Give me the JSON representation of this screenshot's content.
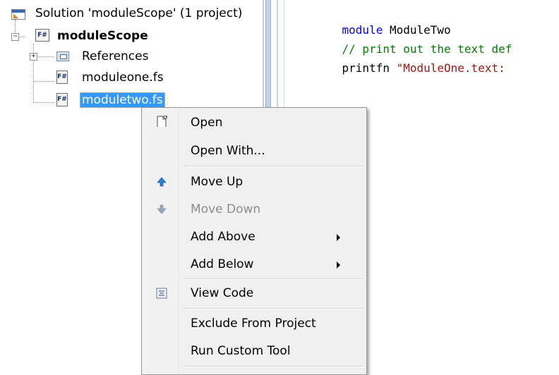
{
  "solution_explorer": {
    "solution_label": "Solution 'moduleScope' (1 project)",
    "project_label": "moduleScope",
    "project_icon_text": "F#",
    "items": [
      {
        "label": "References",
        "icon": "references-icon"
      },
      {
        "label": "moduleone.fs",
        "icon": "fsharp-file-icon",
        "icon_text": "F#"
      },
      {
        "label": "moduletwo.fs",
        "icon": "fsharp-file-icon",
        "icon_text": "F#",
        "selected": true
      }
    ]
  },
  "editor": {
    "lines": [
      {
        "keyword": "module",
        "rest": " ModuleTwo"
      },
      {
        "comment": "// print out the text def"
      },
      {
        "plain": "printfn ",
        "string": "\"ModuleOne.text:"
      }
    ]
  },
  "context_menu": {
    "items": [
      {
        "label": "Open",
        "icon": "open-document-icon",
        "enabled": true
      },
      {
        "label": "Open With...",
        "enabled": true
      },
      {
        "label": "Move Up",
        "icon": "arrow-up-icon",
        "enabled": true
      },
      {
        "label": "Move Down",
        "icon": "arrow-down-icon",
        "enabled": false
      },
      {
        "label": "Add Above",
        "enabled": true,
        "submenu": true
      },
      {
        "label": "Add Below",
        "enabled": true,
        "submenu": true
      },
      {
        "label": "View Code",
        "icon": "view-code-icon",
        "enabled": true
      },
      {
        "label": "Exclude From Project",
        "enabled": true
      },
      {
        "label": "Run Custom Tool",
        "enabled": true
      }
    ]
  },
  "colors": {
    "selection": "#3399ff",
    "keyword": "#0000ff",
    "comment": "#008000",
    "string": "#a31515",
    "menu_background": "#f0f0f0",
    "arrow_up": "#2f7fd6",
    "arrow_down_disabled": "#9aa6b8"
  }
}
